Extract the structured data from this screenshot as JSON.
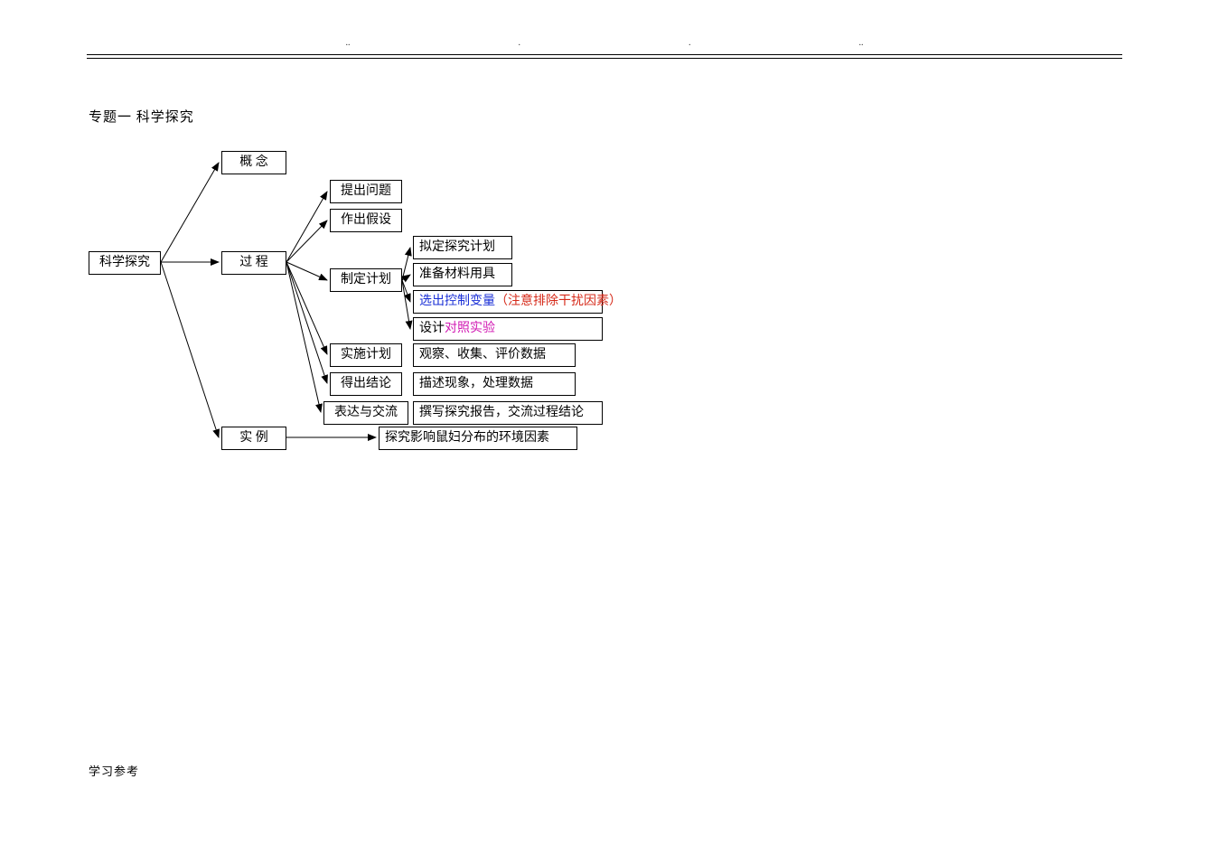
{
  "header": {
    "dots": [
      "..",
      ".",
      ".",
      ".."
    ]
  },
  "title": "专题一   科学探究",
  "footer": "学习参考",
  "diagram": {
    "root": "科学探究",
    "branches": {
      "concept": "概    念",
      "process": {
        "label": "过    程",
        "steps": {
          "s1": "提出问题",
          "s2": "作出假设",
          "s3": {
            "label": "制定计划",
            "sub": {
              "a": "拟定探究计划",
              "b": "准备材料用具",
              "c": {
                "t1": "选出控制变量",
                "t2": "（注意排除干扰因素）"
              },
              "d": {
                "t1": "设计",
                "t2": "对照实验"
              }
            }
          },
          "s4": {
            "label": "实施计划",
            "desc": "观察、收集、评价数据"
          },
          "s5": {
            "label": "得出结论",
            "desc": "描述现象，处理数据"
          },
          "s6": {
            "label": "表达与交流",
            "desc": "撰写探究报告，交流过程结论"
          }
        }
      },
      "example": {
        "label": "实    例",
        "desc": "探究影响鼠妇分布的环境因素"
      }
    }
  }
}
